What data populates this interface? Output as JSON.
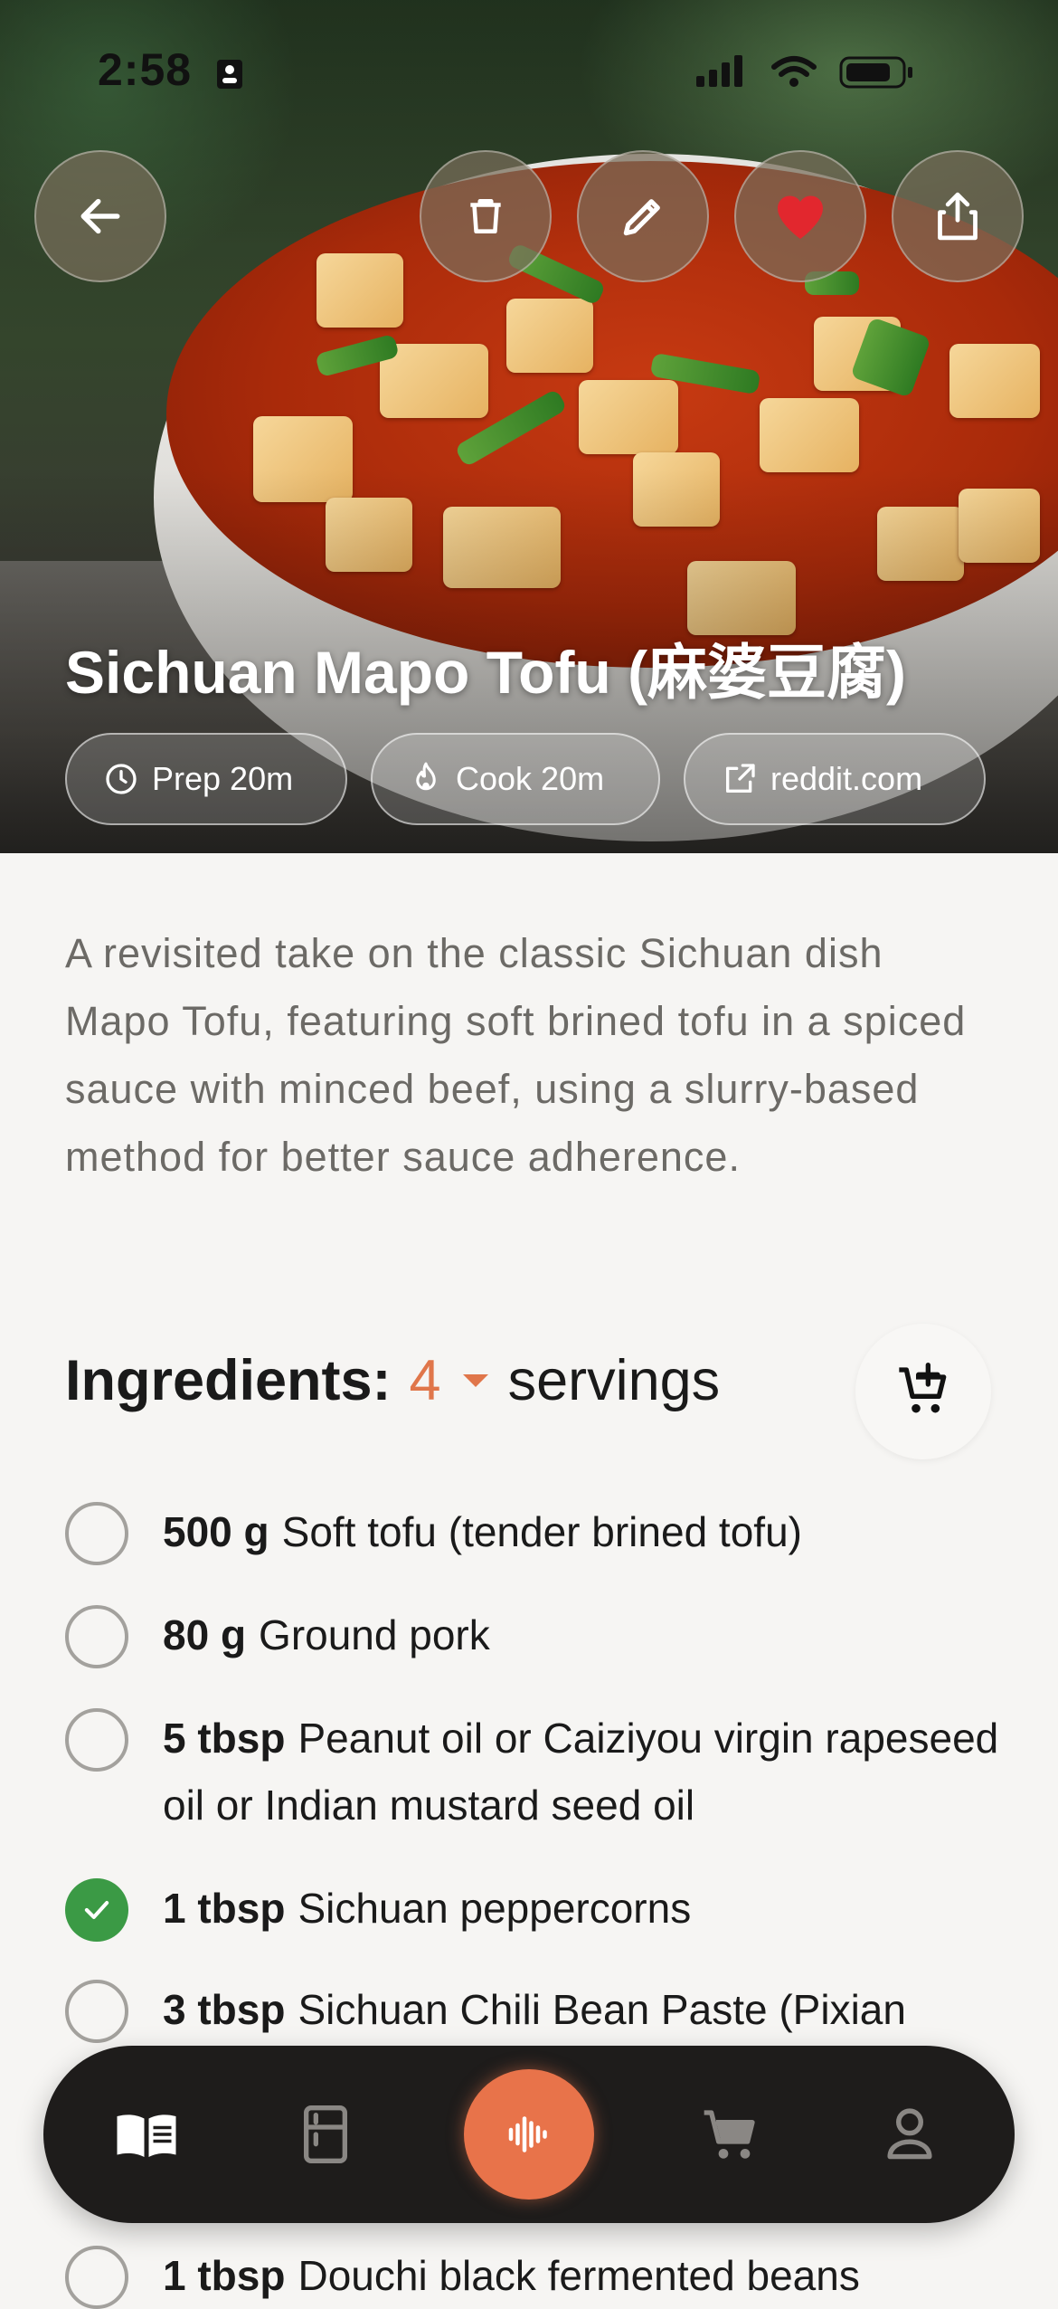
{
  "status_bar": {
    "time": "2:58"
  },
  "recipe": {
    "title": "Sichuan Mapo Tofu (麻婆豆腐)",
    "chips": [
      {
        "icon": "clock-icon",
        "label": "Prep 20m"
      },
      {
        "icon": "flame-icon",
        "label": "Cook 20m"
      },
      {
        "icon": "external-link-icon",
        "label": "reddit.com"
      }
    ],
    "description": "A revisited take on the classic Sichuan dish Mapo Tofu, featuring soft brined tofu in a spiced sauce with minced beef, using a slurry-based method for better sauce adherence."
  },
  "header_actions": [
    "back-icon",
    "trash-icon",
    "pencil-icon",
    "heart-icon",
    "share-icon"
  ],
  "ingredients": {
    "label": "Ingredients:",
    "servings_value": "4",
    "servings_label": "servings",
    "items": [
      {
        "amount": "500 g",
        "name": "Soft tofu (tender brined tofu)",
        "checked": false
      },
      {
        "amount": "80 g",
        "name": "Ground pork",
        "checked": false
      },
      {
        "amount": "5 tbsp",
        "name": "Peanut oil or Caiziyou virgin rapeseed oil or Indian mustard seed oil",
        "checked": false
      },
      {
        "amount": "1 tbsp",
        "name": "Sichuan peppercorns",
        "checked": true
      },
      {
        "amount": "3 tbsp",
        "name": "Sichuan Chili Bean Paste (Pixian",
        "checked": false
      },
      {
        "amount": "1 tbsp",
        "name": "Douchi black fermented beans",
        "checked": false
      }
    ]
  },
  "colors": {
    "accent": "#e0764a",
    "checked": "#3b9a45",
    "nav_bg": "#1e1c1b"
  },
  "nav": [
    "book-icon",
    "fridge-icon",
    "microphone-icon",
    "cart-icon",
    "profile-icon"
  ]
}
